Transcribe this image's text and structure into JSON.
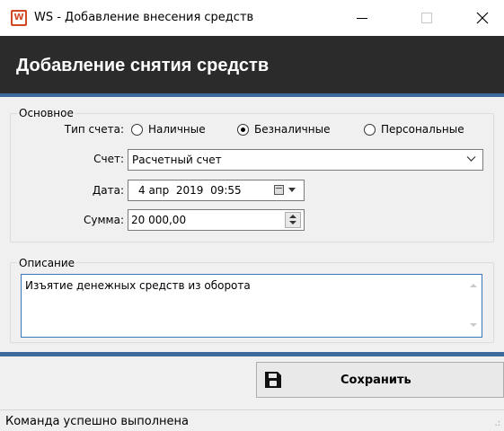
{
  "window": {
    "icon_letter": "W",
    "title": "WS - Добавление внесения средств"
  },
  "header": {
    "title": "Добавление снятия средств"
  },
  "basic": {
    "legend": "Основное",
    "account_type_label": "Тип счета:",
    "account_types": [
      {
        "label": "Наличные",
        "checked": false
      },
      {
        "label": "Безналичные",
        "checked": true
      },
      {
        "label": "Персональные",
        "checked": false
      }
    ],
    "account_label": "Счет:",
    "account_value": "Расчетный счет",
    "date_label": "Дата:",
    "date_value": "4 апр  2019  09:55",
    "amount_label": "Сумма:",
    "amount_value": "20 000,00"
  },
  "description": {
    "legend": "Описание",
    "value": "Изъятие денежных средств из оборота"
  },
  "save_button": {
    "label": "Сохранить"
  },
  "status": {
    "text": "Команда успешно выполнена"
  },
  "colors": {
    "header_bg": "#2b2b2b",
    "accent": "#3d6a9c",
    "icon": "#d24726"
  }
}
